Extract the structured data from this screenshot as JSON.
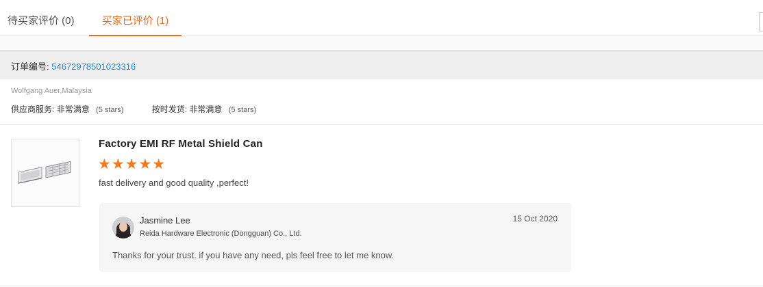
{
  "tabs": [
    {
      "label": "待买家评价 (0)"
    },
    {
      "label": "买家已评价 (1)"
    }
  ],
  "order": {
    "label": "订单编号:",
    "number": "54672978501023316"
  },
  "buyer": {
    "name_location": "Wolfgang Auer,Malaysia"
  },
  "ratings": [
    {
      "label": "供应商服务:",
      "value": "非常满意",
      "note": "(5 stars)"
    },
    {
      "label": "按时发货:",
      "value": "非常满意",
      "note": "(5 stars)"
    }
  ],
  "review": {
    "product_title": "Factory EMI RF Metal Shield Can",
    "stars": "★★★★★",
    "star_rating": 5,
    "star_color": "#f27a1a",
    "comment": "fast delivery and good quality ,perfect!"
  },
  "reply": {
    "name": "Jasmine Lee",
    "company": "Reida Hardware Electronic (Dongguan) Co., Ltd.",
    "date": "15 Oct 2020",
    "text": "Thanks for your trust. if you have any need, pls feel free to let me know."
  },
  "colors": {
    "accent": "#e36d1e",
    "link": "#1a8fd6"
  }
}
